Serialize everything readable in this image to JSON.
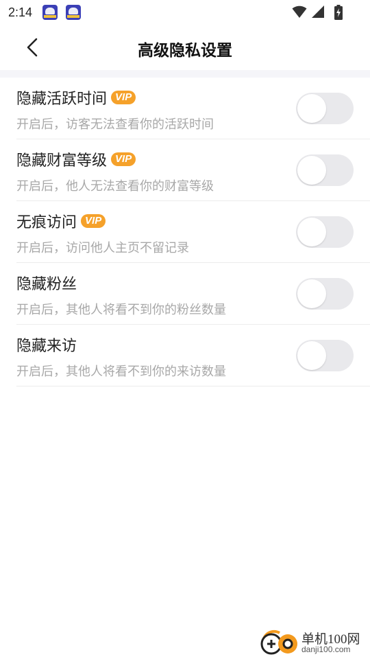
{
  "status_bar": {
    "time": "2:14"
  },
  "header": {
    "title": "高级隐私设置"
  },
  "settings": [
    {
      "title": "隐藏活跃时间",
      "vip": true,
      "badge": "VIP",
      "desc": "开启后，访客无法查看你的活跃时间",
      "enabled": false
    },
    {
      "title": "隐藏财富等级",
      "vip": true,
      "badge": "VIP",
      "desc": "开启后，他人无法查看你的财富等级",
      "enabled": false
    },
    {
      "title": "无痕访问",
      "vip": true,
      "badge": "VIP",
      "desc": "开启后，访问他人主页不留记录",
      "enabled": false
    },
    {
      "title": "隐藏粉丝",
      "vip": false,
      "badge": "",
      "desc": "开启后，其他人将看不到你的粉丝数量",
      "enabled": false
    },
    {
      "title": "隐藏来访",
      "vip": false,
      "badge": "",
      "desc": "开启后，其他人将看不到你的来访数量",
      "enabled": false
    }
  ],
  "watermark": {
    "brand": "单机100网",
    "url": "danji100.com"
  },
  "colors": {
    "vip_badge": "#f5a12a",
    "toggle_off_track": "#e9e9ec",
    "toggle_knob": "#ffffff",
    "title_text": "#222222",
    "desc_text": "#a8a8a8",
    "divider": "#ececec"
  },
  "icons": {
    "back": "chevron-left-icon",
    "wifi": "wifi-icon",
    "signal": "cell-signal-icon",
    "battery": "battery-charging-icon",
    "notification_app": "app-notification-icon"
  }
}
